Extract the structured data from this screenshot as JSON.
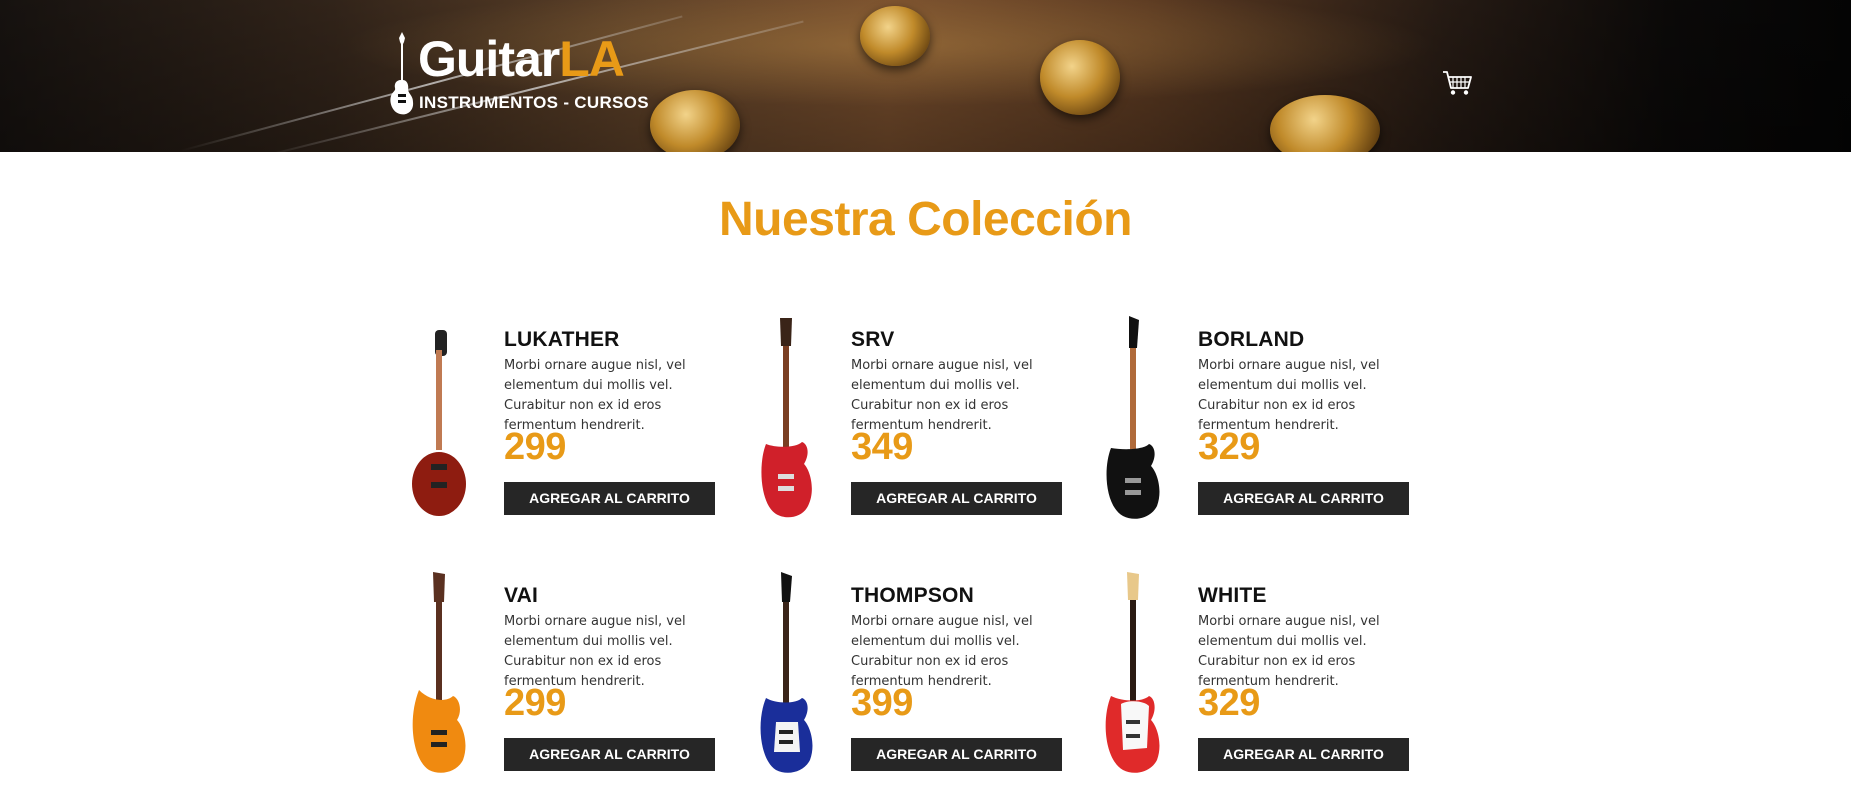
{
  "header": {
    "logo_main": "Guitar",
    "logo_accent": "LA",
    "logo_sub": "INSTRUMENTOS - CURSOS",
    "cart_icon": "shopping-cart-icon"
  },
  "main": {
    "title": "Nuestra Colección",
    "products": [
      {
        "name": "LUKATHER",
        "description": "Morbi ornare augue nisl, vel elementum dui mollis vel. Curabitur non ex id eros fermentum hendrerit.",
        "price": "299",
        "button": "AGREGAR AL CARRITO",
        "body_color": "#8e1c10",
        "neck_color": "#c07a52"
      },
      {
        "name": "SRV",
        "description": "Morbi ornare augue nisl, vel elementum dui mollis vel. Curabitur non ex id eros fermentum hendrerit.",
        "price": "349",
        "button": "AGREGAR AL CARRITO",
        "body_color": "#d0202a",
        "neck_color": "#7a3e22"
      },
      {
        "name": "BORLAND",
        "description": "Morbi ornare augue nisl, vel elementum dui mollis vel. Curabitur non ex id eros fermentum hendrerit.",
        "price": "329",
        "button": "AGREGAR AL CARRITO",
        "body_color": "#111111",
        "neck_color": "#b06a3a"
      },
      {
        "name": "VAI",
        "description": "Morbi ornare augue nisl, vel elementum dui mollis vel. Curabitur non ex id eros fermentum hendrerit.",
        "price": "299",
        "button": "AGREGAR AL CARRITO",
        "body_color": "#f08a10",
        "neck_color": "#5a3020"
      },
      {
        "name": "THOMPSON",
        "description": "Morbi ornare augue nisl, vel elementum dui mollis vel. Curabitur non ex id eros fermentum hendrerit.",
        "price": "399",
        "button": "AGREGAR AL CARRITO",
        "body_color": "#1a2e9a",
        "neck_color": "#3a2418"
      },
      {
        "name": "WHITE",
        "description": "Morbi ornare augue nisl, vel elementum dui mollis vel. Curabitur non ex id eros fermentum hendrerit.",
        "price": "329",
        "button": "AGREGAR AL CARRITO",
        "body_color": "#e02a2a",
        "neck_color": "#f2d8a0"
      }
    ]
  },
  "colors": {
    "accent": "#e89a17",
    "button_bg": "#262626"
  }
}
